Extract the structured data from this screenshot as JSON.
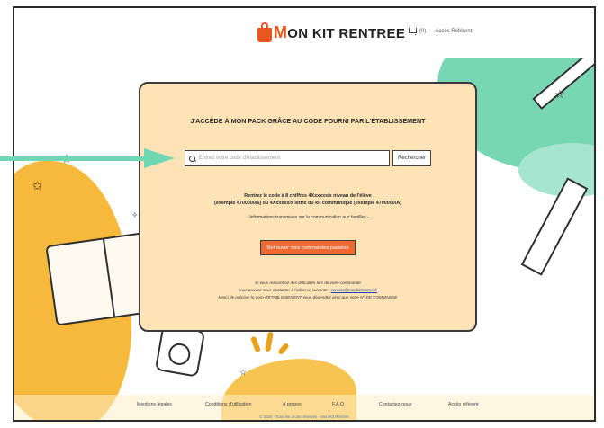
{
  "header": {
    "logo_text": "ON KIT RENTREE",
    "logo_letter": "M",
    "cart_count": "(0)",
    "account_label": "Accès Référent"
  },
  "card": {
    "title": "J'ACCÈDE À MON PACK GRÂCE AU CODE FOURNI PAR L'ÉTABLISSEMENT",
    "search": {
      "placeholder": "Entrez votre code d'établissement",
      "button_label": "Rechercher"
    },
    "info_line1": "Rentrez le code à 8 chiffres 4Xxxxxx/x niveau de l'élève",
    "info_line2": "(exemple 4700000/6) ou 4Xxxxxx/x lettre du kit communiqué (exemple 4700000/A)",
    "info_note": "- Informations transmises sur la communication aux familles -",
    "orders_button_label": "Retrouver mes commandes passées",
    "help_line1": "Si vous rencontrez des difficultés lors de votre commande",
    "help_line2_prefix": "vous pouvez nous contacter à l'adresse suivante :",
    "help_email": "contact@monkitrentree.fr",
    "help_line3": "Merci de préciser le nom d'ÉTABLISSEMENT vous dépendez ainsi que votre N° DE COMMANDE"
  },
  "footer": {
    "links": [
      "Mentions légales",
      "Conditions d'utilisation",
      "À propos",
      "F.A.Q",
      "Contactez-nous",
      "Accès référent"
    ],
    "copyright": "© 2024 - Tous les droits réservés - Mon Kit Rentrée"
  },
  "colors": {
    "card_bg": "#fde3b5",
    "accent_orange": "#ef6a33",
    "arrow_green": "#6fd7b1",
    "yellow": "#f6b93b",
    "green": "#77d6b3"
  }
}
